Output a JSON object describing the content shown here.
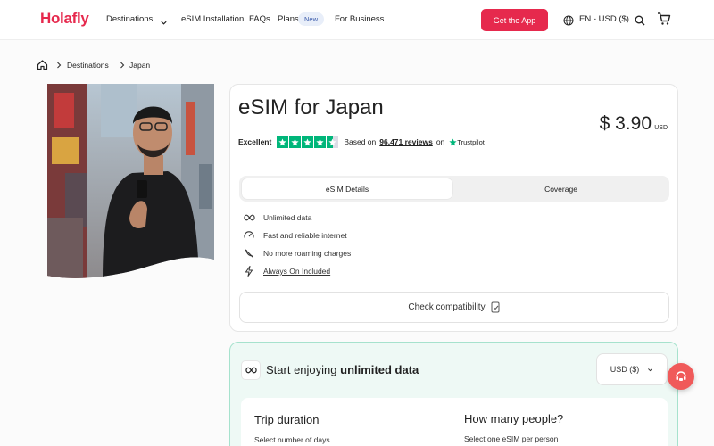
{
  "header": {
    "logo": "Holafly",
    "nav": {
      "destinations": "Destinations",
      "esim_installation": "eSIM Installation",
      "faqs": "FAQs",
      "plans": "Plans",
      "plans_badge": "New",
      "for_business": "For Business"
    },
    "get_app": "Get the App",
    "language": "EN - USD ($)"
  },
  "breadcrumb": {
    "items": [
      "Destinations",
      "Japan"
    ]
  },
  "product": {
    "title": "eSIM for Japan",
    "price": "$ 3.90",
    "currency": "USD",
    "rating": {
      "label": "Excellent",
      "stars": 4.5,
      "based_on": "Based on",
      "reviews": "96,471 reviews",
      "on": "on",
      "provider": "Trustpilot"
    },
    "tabs": [
      "eSIM Details",
      "Coverage"
    ],
    "features": [
      {
        "icon": "infinity-icon",
        "text": "Unlimited data"
      },
      {
        "icon": "speedometer-icon",
        "text": "Fast and reliable internet"
      },
      {
        "icon": "no-roaming-icon",
        "text": "No more roaming charges"
      },
      {
        "icon": "lightning-icon",
        "text": "Always On Included"
      }
    ],
    "check_compatibility": "Check compatibility"
  },
  "plan": {
    "title_prefix": "Start enjoying",
    "title_bold": "unlimited data",
    "currency_select": "USD ($)",
    "trip_duration": {
      "title": "Trip duration",
      "subtitle": "Select number of days"
    },
    "people": {
      "title": "How many people?",
      "subtitle": "Select one eSIM per person"
    }
  },
  "colors": {
    "brand": "#e6294d",
    "trustpilot_green": "#00b67a",
    "plan_bg": "#eef9f5",
    "plan_border": "#a6e2cd"
  }
}
